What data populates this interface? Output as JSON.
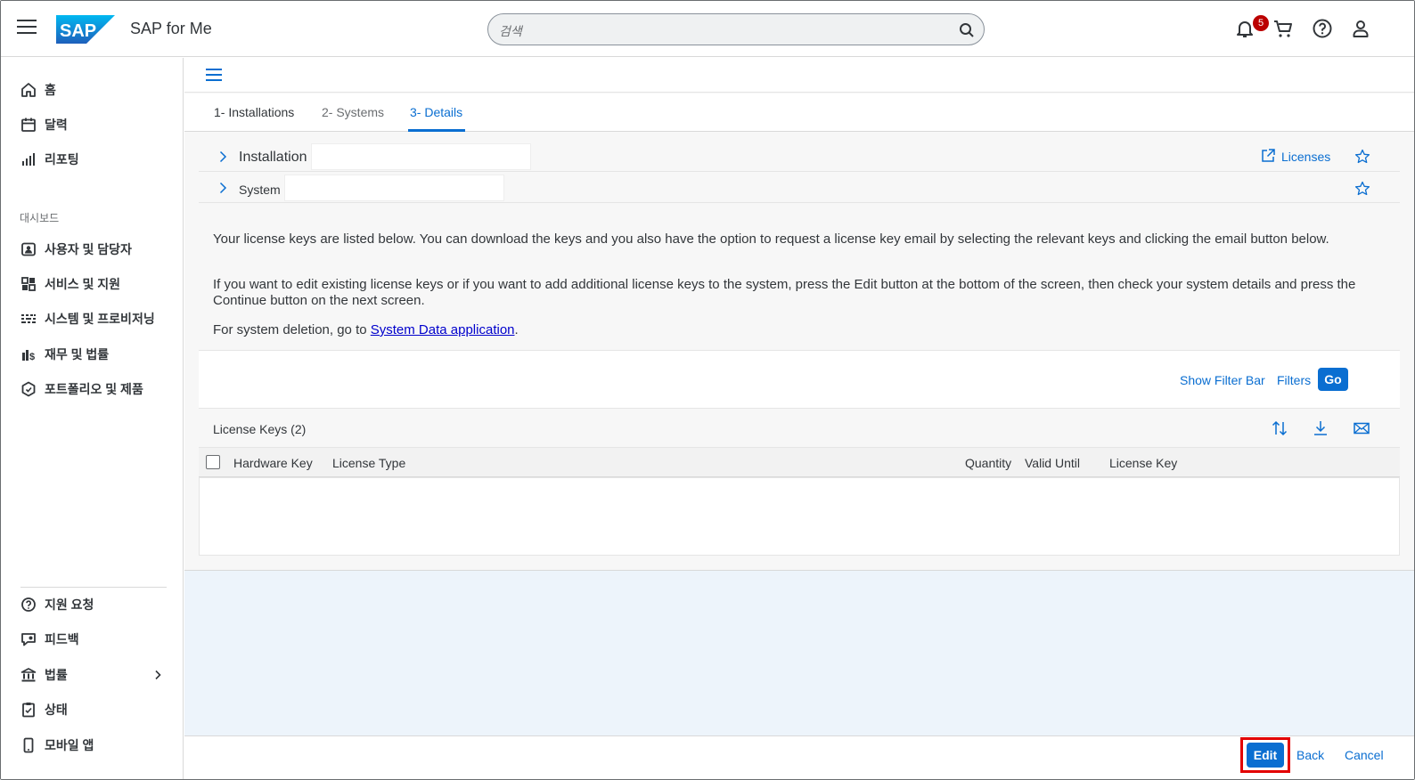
{
  "shell": {
    "logo_text": "SAP",
    "app_title": "SAP for Me",
    "search_placeholder": "검색",
    "notification_count": "5"
  },
  "sidenav": {
    "top_items": [
      {
        "label": "홈",
        "icon": "home-icon"
      },
      {
        "label": "달력",
        "icon": "calendar-icon"
      },
      {
        "label": "리포팅",
        "icon": "bar-chart-icon"
      }
    ],
    "group_label": "대시보드",
    "dashboard_items": [
      {
        "label": "사용자 및 담당자",
        "icon": "contacts-icon"
      },
      {
        "label": "서비스 및 지원",
        "icon": "services-icon"
      },
      {
        "label": "시스템 및 프로비저닝",
        "icon": "systems-icon"
      },
      {
        "label": "재무 및 법률",
        "icon": "finance-icon"
      },
      {
        "label": "포트폴리오 및 제품",
        "icon": "portfolio-icon"
      }
    ],
    "bottom_items": [
      {
        "label": "지원 요청",
        "icon": "help-icon"
      },
      {
        "label": "피드백",
        "icon": "feedback-icon"
      },
      {
        "label": "법률",
        "icon": "legal-icon"
      },
      {
        "label": "상태",
        "icon": "status-icon"
      },
      {
        "label": "모바일 앱",
        "icon": "mobile-icon"
      }
    ]
  },
  "tabs": [
    {
      "label": "1- Installations"
    },
    {
      "label": "2- Systems"
    },
    {
      "label": "3- Details"
    }
  ],
  "header": {
    "installation_label": "Installation",
    "installation_value": "",
    "system_label": "System",
    "system_value": "",
    "licenses_link": "Licenses"
  },
  "info": {
    "p1": "Your license keys are listed below. You can download the keys and you also have the option to request a license key email by selecting the relevant keys and clicking the email button below.",
    "p2": "If you want to edit existing license keys or if you want to add additional license keys to the system, press the Edit button at the bottom of the screen, then check your system details and press the Continue button on the next screen.",
    "p3_prefix": "For system deletion, go to ",
    "p3_link": "System Data application",
    "p3_suffix": "."
  },
  "filterbar": {
    "show_filter_bar": "Show Filter Bar",
    "filters": "Filters",
    "go": "Go"
  },
  "table": {
    "title": "License Keys (2)",
    "columns": [
      "Hardware Key",
      "License Type",
      "Quantity",
      "Valid Until",
      "License Key"
    ],
    "rows": []
  },
  "footer": {
    "edit": "Edit",
    "back": "Back",
    "cancel": "Cancel"
  },
  "colors": {
    "accent": "#0a6ed1",
    "badge": "#bb0000",
    "highlight": "#e30000"
  }
}
